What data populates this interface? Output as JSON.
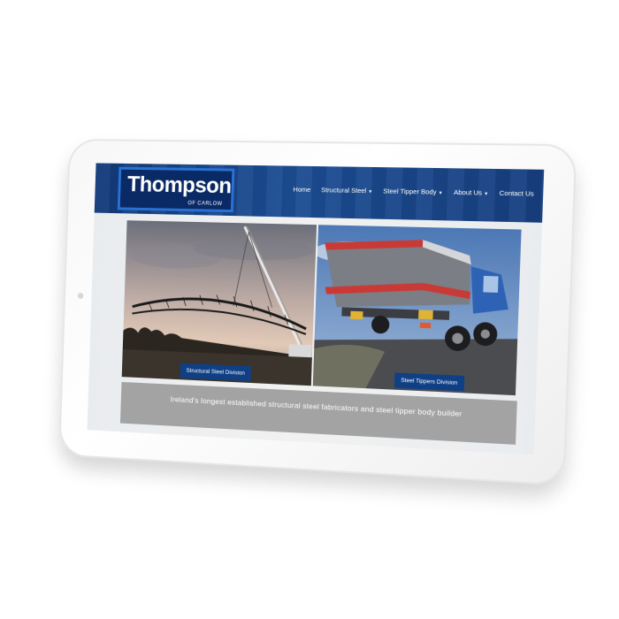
{
  "site": {
    "logo": {
      "name": "Thompson",
      "sub": "OF CARLOW"
    },
    "nav": [
      {
        "label": "Home",
        "has_dropdown": false
      },
      {
        "label": "Structural Steel",
        "has_dropdown": true
      },
      {
        "label": "Steel Tipper Body",
        "has_dropdown": true
      },
      {
        "label": "About Us",
        "has_dropdown": true
      },
      {
        "label": "Contact Us",
        "has_dropdown": false
      }
    ],
    "panels": {
      "left_caption": "Structural Steel Division",
      "right_caption": "Steel Tippers Division"
    },
    "tagline": "Ireland's longest established structural steel fabricators and steel tipper body builder"
  },
  "colors": {
    "header_blue": "#173f80",
    "caption_blue": "#0f3f85",
    "tagline_bar": "#a3a3a3"
  },
  "icons": {
    "dropdown": "caret-down-icon"
  }
}
